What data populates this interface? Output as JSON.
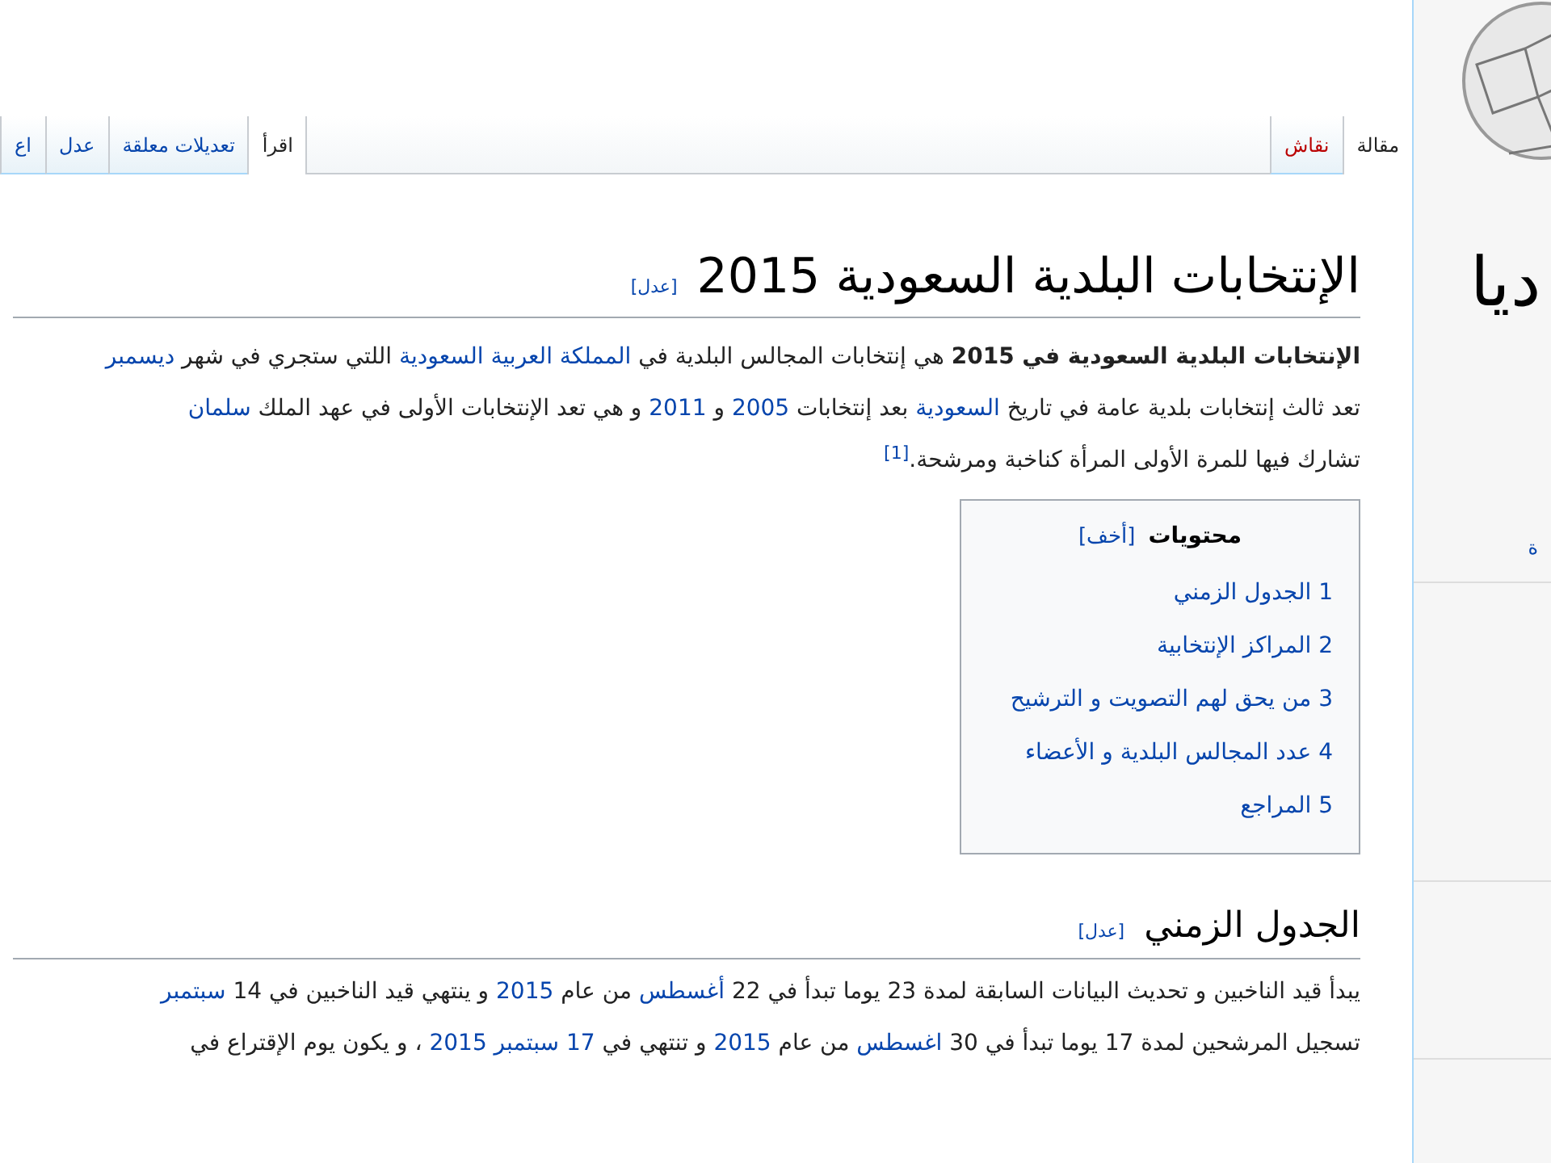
{
  "sidebar": {
    "logo_text": "ديا",
    "items": [
      "ة"
    ]
  },
  "tabs_right": [
    {
      "label": "مقالة",
      "selected": true,
      "redlink": false
    },
    {
      "label": "نقاش",
      "selected": false,
      "redlink": true
    }
  ],
  "tabs_left": [
    {
      "label": "اقرأ",
      "selected": true,
      "redlink": false
    },
    {
      "label": "تعديلات معلقة",
      "selected": false,
      "redlink": false
    },
    {
      "label": "عدل",
      "selected": false,
      "redlink": false
    },
    {
      "label": "اع",
      "selected": false,
      "redlink": false
    }
  ],
  "title": {
    "text": "الإنتخابات البلدية السعودية 2015",
    "edit": "[عدل]"
  },
  "intro": [
    [
      {
        "text": "الإنتخابات البلدية السعودية في 2015",
        "kind": "bold"
      },
      {
        "text": " هي إنتخابات المجالس البلدية في ",
        "kind": "plain"
      },
      {
        "text": "المملكة العربية السعودية",
        "kind": "link"
      },
      {
        "text": " اللتي ستجري في شهر ",
        "kind": "plain"
      },
      {
        "text": "ديسمبر",
        "kind": "link"
      }
    ],
    [
      {
        "text": "تعد ثالث إنتخابات بلدية عامة في تاريخ ",
        "kind": "plain"
      },
      {
        "text": "السعودية",
        "kind": "link"
      },
      {
        "text": " بعد إنتخابات ",
        "kind": "plain"
      },
      {
        "text": "2005",
        "kind": "link"
      },
      {
        "text": " و ",
        "kind": "plain"
      },
      {
        "text": "2011",
        "kind": "link"
      },
      {
        "text": " و هي تعد الإنتخابات الأولى في عهد الملك ",
        "kind": "plain"
      },
      {
        "text": "سلمان",
        "kind": "link"
      }
    ],
    [
      {
        "text": "تشارك فيها للمرة الأولى المرأة كناخبة ومرشحة.",
        "kind": "plain"
      },
      {
        "text": "[1]",
        "kind": "ref"
      }
    ]
  ],
  "toc": {
    "title": "محتويات",
    "toggle": "[أخف]",
    "items": [
      {
        "number": "1",
        "label": "الجدول الزمني"
      },
      {
        "number": "2",
        "label": "المراكز الإنتخابية"
      },
      {
        "number": "3",
        "label": "من يحق لهم التصويت و الترشيح"
      },
      {
        "number": "4",
        "label": "عدد المجالس البلدية و الأعضاء"
      },
      {
        "number": "5",
        "label": "المراجع"
      }
    ]
  },
  "section": {
    "heading": "الجدول الزمني",
    "edit": "[عدل]",
    "lines": [
      [
        {
          "text": "يبدأ قيد الناخبين و تحديث البيانات السابقة لمدة 23 يوما تبدأ في 22 ",
          "kind": "plain"
        },
        {
          "text": "أغسطس",
          "kind": "link"
        },
        {
          "text": " من عام ",
          "kind": "plain"
        },
        {
          "text": "2015",
          "kind": "link"
        },
        {
          "text": " و ينتهي قيد الناخبين في 14 ",
          "kind": "plain"
        },
        {
          "text": "سبتمبر",
          "kind": "link"
        }
      ],
      [
        {
          "text": "تسجيل المرشحين لمدة 17 يوما تبدأ في 30 ",
          "kind": "plain"
        },
        {
          "text": "اغسطس",
          "kind": "link"
        },
        {
          "text": " من عام ",
          "kind": "plain"
        },
        {
          "text": "2015",
          "kind": "link"
        },
        {
          "text": " و تنتهي في ",
          "kind": "plain"
        },
        {
          "text": "17 سبتمبر 2015",
          "kind": "link"
        },
        {
          "text": " ، و يكون يوم الإقتراع في",
          "kind": "plain"
        }
      ]
    ]
  }
}
